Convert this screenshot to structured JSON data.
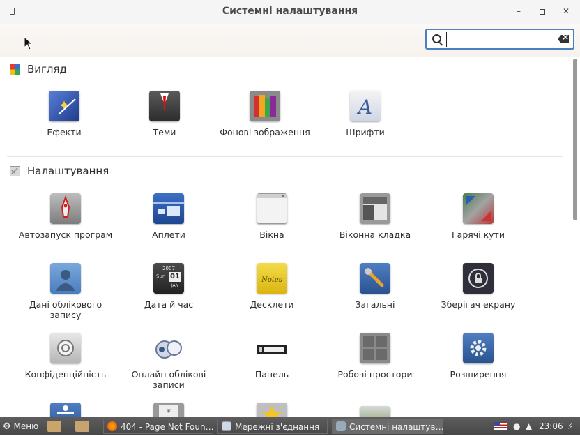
{
  "window": {
    "title": "Системні налаштування"
  },
  "search": {
    "value": "",
    "placeholder": ""
  },
  "sections": [
    {
      "title": "Вигляд",
      "items": [
        {
          "label": "Ефекти",
          "icon": "effects-icon"
        },
        {
          "label": "Теми",
          "icon": "themes-icon"
        },
        {
          "label": "Фонові зображення",
          "icon": "backgrounds-icon"
        },
        {
          "label": "Шрифти",
          "icon": "fonts-icon"
        }
      ]
    },
    {
      "title": "Налаштування",
      "items": [
        {
          "label": "Автозапуск програм",
          "icon": "startup-apps-icon"
        },
        {
          "label": "Аплети",
          "icon": "applets-icon"
        },
        {
          "label": "Вікна",
          "icon": "windows-icon"
        },
        {
          "label": "Віконна кладка",
          "icon": "window-tiling-icon"
        },
        {
          "label": "Гарячі кути",
          "icon": "hot-corners-icon"
        },
        {
          "label": "Дані облікового запису",
          "icon": "account-details-icon"
        },
        {
          "label": "Дата й час",
          "icon": "date-time-icon"
        },
        {
          "label": "Десклети",
          "icon": "desklets-icon"
        },
        {
          "label": "Загальні",
          "icon": "general-icon"
        },
        {
          "label": "Зберігач екрану",
          "icon": "screensaver-icon"
        },
        {
          "label": "Конфіденційність",
          "icon": "privacy-icon"
        },
        {
          "label": "Онлайн облікові записи",
          "icon": "online-accounts-icon"
        },
        {
          "label": "Панель",
          "icon": "panel-icon"
        },
        {
          "label": "Робочі простори",
          "icon": "workspaces-icon"
        },
        {
          "label": "Розширення",
          "icon": "extensions-icon"
        }
      ]
    }
  ],
  "date_icon": {
    "year": "2007",
    "day_name": "Sun",
    "day": "01",
    "month": "JAN"
  },
  "taskbar": {
    "menu_label": "Меню",
    "tasks": [
      {
        "label": "404 - Page Not Foun…",
        "icon": "firefox-icon"
      },
      {
        "label": "Мережні з'єднання",
        "icon": "network-connections-icon"
      },
      {
        "label": "Системні налаштув…",
        "icon": "system-settings-icon"
      }
    ],
    "clock": "23:06"
  },
  "colors": {
    "search_border": "#4a7fc0",
    "taskbar": "#4f4f4f"
  }
}
